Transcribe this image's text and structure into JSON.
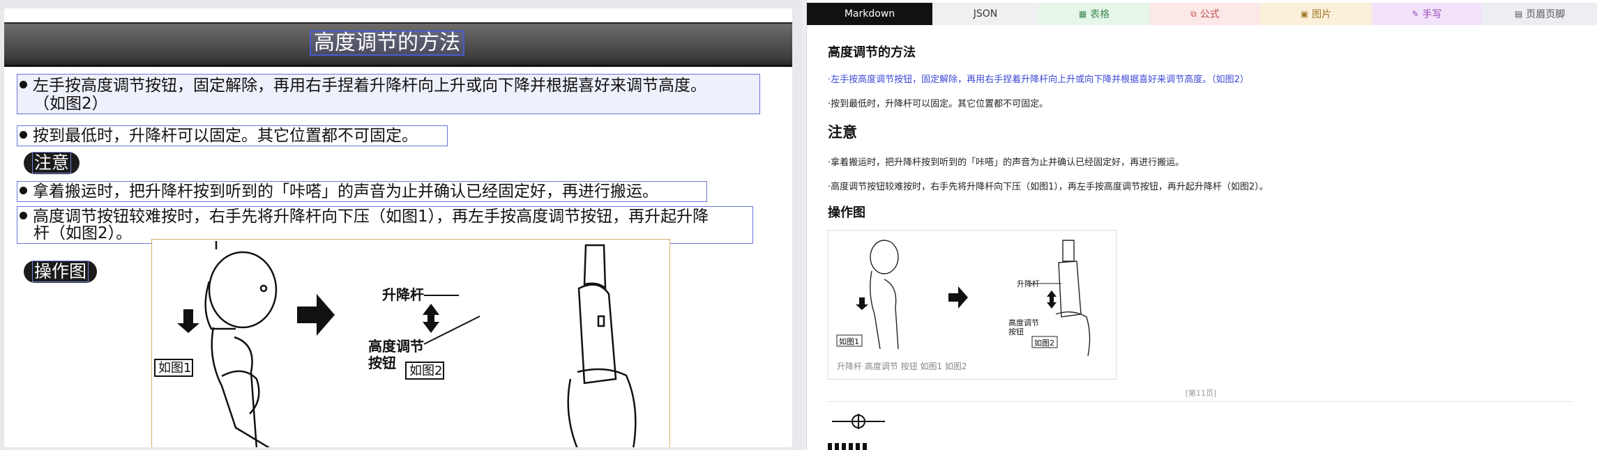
{
  "document": {
    "title": "高度调节的方法",
    "bullets": [
      {
        "line1": "左手按高度调节按钮，固定解除，再用右手捏着升降杆向上升或向下降并根据喜好来调节高度。",
        "line2": "（如图2）"
      },
      {
        "line1": "按到最低时，升降杆可以固定。其它位置都不可固定。",
        "line2": ""
      }
    ],
    "notice_label": "注意",
    "notices": [
      {
        "line1": "拿着搬运时，把升降杆按到听到的「咔嗒」的声音为止并确认已经固定好，再进行搬运。",
        "line2": ""
      },
      {
        "line1": "高度调节按钮较难按时，右手先将升降杆向下压（如图1），再左手按高度调节按钮，再升起升降",
        "line2": "杆（如图2）。"
      }
    ],
    "operation_label": "操作图",
    "figure": {
      "label_lift_rod": "升降杆",
      "label_adjust_1": "高度调节",
      "label_adjust_2": "按钮",
      "caption_1": "如图1",
      "caption_2": "如图2"
    }
  },
  "tabs": [
    {
      "label": "Markdown",
      "icon": ""
    },
    {
      "label": "JSON",
      "icon": ""
    },
    {
      "label": "表格",
      "icon": "table-icon"
    },
    {
      "label": "公式",
      "icon": "formula-icon"
    },
    {
      "label": "图片",
      "icon": "image-icon"
    },
    {
      "label": "手写",
      "icon": "handwriting-icon"
    },
    {
      "label": "页眉页脚",
      "icon": "header-footer-icon"
    }
  ],
  "markdown": {
    "h_title": "高度调节的方法",
    "p1": "·左手按高度调节按钮，固定解除，再用右手捏着升降杆向上升或向下降并根据喜好来调节高度。（如图2）",
    "p2": "·按到最低时，升降杆可以固定。其它位置都不可固定。",
    "h_notice": "注意",
    "p3": "·拿着搬运时，把升降杆按到听到的「咔嗒」的声音为止并确认已经固定好，再进行搬运。",
    "p4": "·高度调节按钮较难按时，右手先将升降杆向下压（如图1），再左手按高度调节按钮，再升起升降杆（如图2）。",
    "h_operation": "操作图",
    "figure_caption": "升降杆 高度调节 按钮 如图1 如图2",
    "page_marker": "[第11页]"
  },
  "colors": {
    "highlight_text": "#3a49d6",
    "detection_box": "#6a74d9",
    "figure_box": "#d7b06a",
    "active_tab": "#111111"
  }
}
